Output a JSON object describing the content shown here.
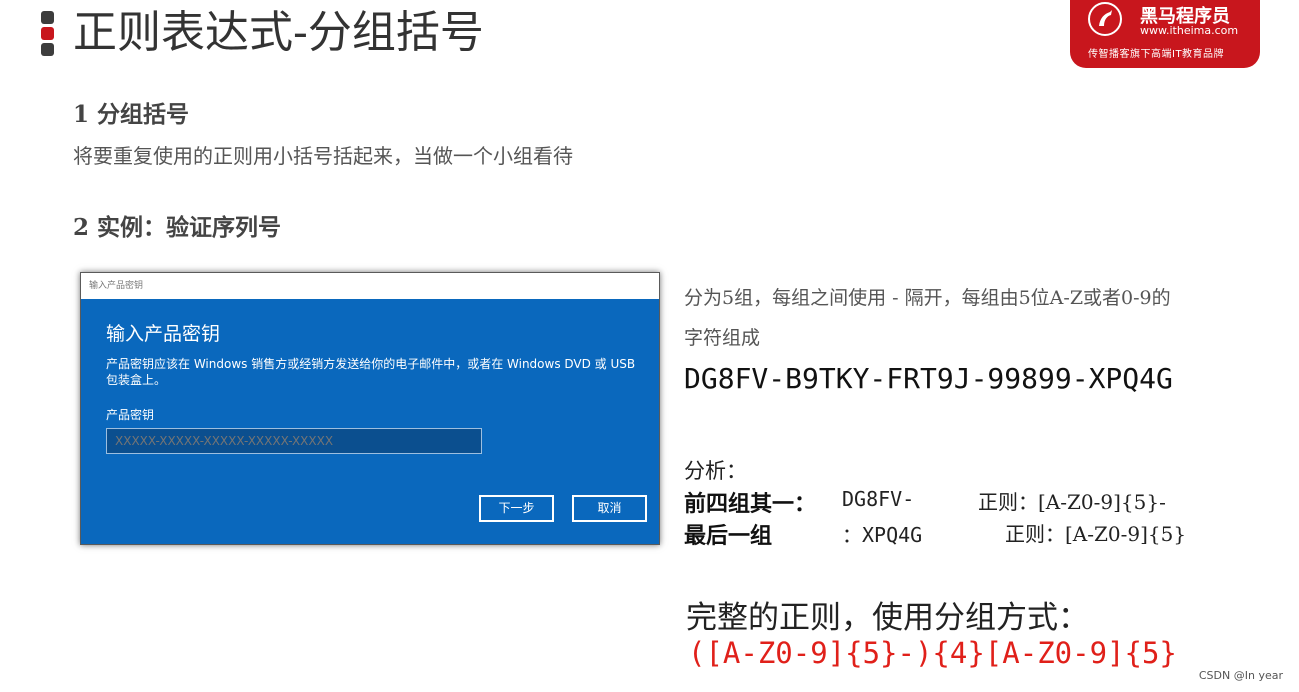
{
  "slide": {
    "title": "正则表达式-分组括号"
  },
  "brand": {
    "name": "黑马程序员",
    "url": "www.itheima.com",
    "slogan": "传智播客旗下高端IT教育品牌",
    "color": "#c8161d"
  },
  "section1": {
    "heading": "1 分组括号",
    "text": "将要重复使用的正则用小括号括起来，当做一个小组看待"
  },
  "section2": {
    "heading": "2 实例：验证序列号"
  },
  "dialog": {
    "window_title": "输入产品密钥",
    "heading": "输入产品密钥",
    "description": "产品密钥应该在 Windows 销售方或经销方发送给你的电子邮件中，或者在 Windows DVD 或 USB 包装盒上。",
    "field_label": "产品密钥",
    "field_placeholder": "XXXXX-XXXXX-XXXXX-XXXXX-XXXXX",
    "next_button": "下一步",
    "cancel_button": "取消",
    "accent_color": "#0a68bd"
  },
  "explanation": {
    "line1": "分为5组，每组之间使用 - 隔开，每组由5位A-Z或者0-9的",
    "line2": "字符组成",
    "serial": "DG8FV-B9TKY-FRT9J-99899-XPQ4G",
    "analysis_label": "分析：",
    "row1_label": "前四组其一：",
    "row1_value": "DG8FV-",
    "row1_regex": "正则：[A-Z0-9]{5}-",
    "row2_label": "最后一组",
    "row2_value": "：XPQ4G",
    "row2_regex": "正则：[A-Z0-9]{5}",
    "complete_title": "完整的正则，使用分组方式：",
    "complete_regex": "([A-Z0-9]{5}-){4}[A-Z0-9]{5}",
    "regex_color": "#e0201a"
  },
  "watermark": "CSDN @In year"
}
